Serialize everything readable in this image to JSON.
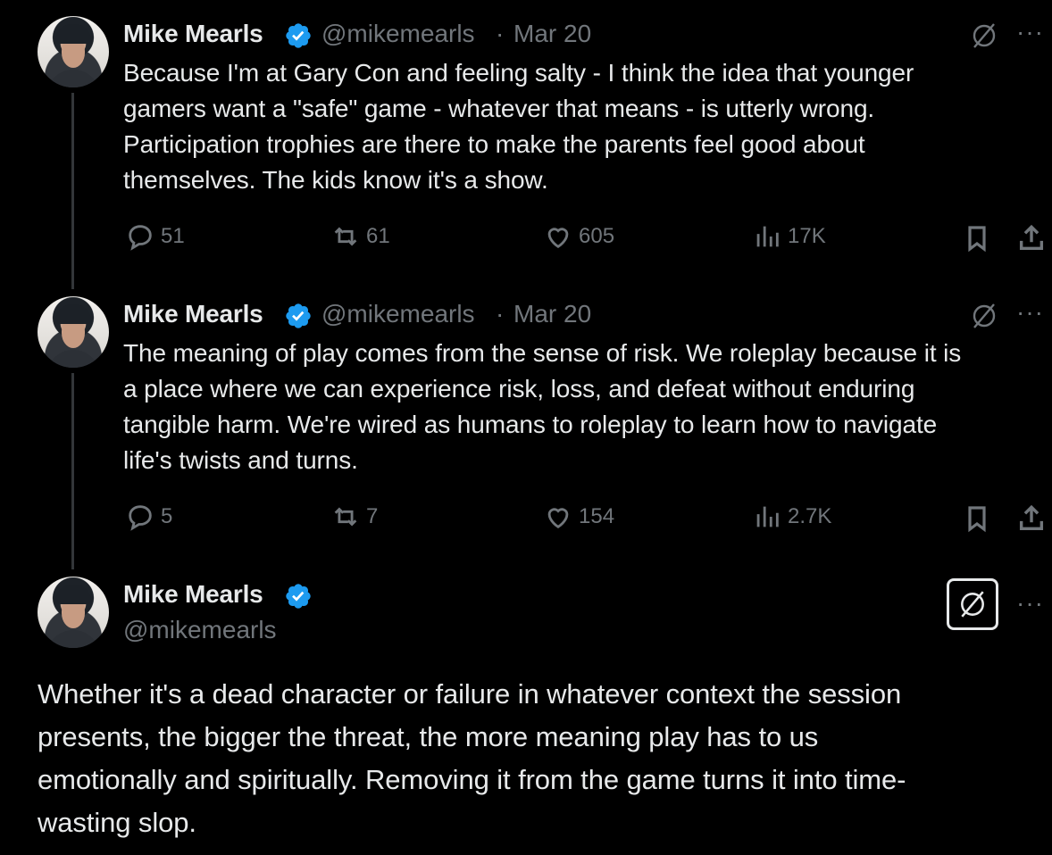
{
  "tweets": [
    {
      "name": "Mike Mearls",
      "handle": "@mikemearls",
      "date": "Mar 20",
      "text": "Because I'm at Gary Con and feeling salty - I think the idea that younger\ngamers want a \"safe\" game - whatever that means - is utterly wrong.\nParticipation trophies are there to make the parents feel good about\nthemselves. The kids know it's a show.",
      "replies": "51",
      "reposts": "61",
      "likes": "605",
      "views": "17K"
    },
    {
      "name": "Mike Mearls",
      "handle": "@mikemearls",
      "date": "Mar 20",
      "text": "The meaning of play comes from the sense of risk. We roleplay because it is\na place where we can experience risk, loss, and defeat without enduring\ntangible harm. We're wired as humans to roleplay to learn how to navigate\nlife's twists and turns.",
      "replies": "5",
      "reposts": "7",
      "likes": "154",
      "views": "2.7K"
    },
    {
      "name": "Mike Mearls",
      "handle": "@mikemearls",
      "text": "Whether it's a dead character or failure in whatever context the session\npresents, the bigger the threat, the more meaning play has to us\nemotionally and spiritually. Removing it from the game turns it into time-\nwasting slop."
    }
  ],
  "separator": "·",
  "more_glyph": "···",
  "colors": {
    "text": "#e7e9ea",
    "muted": "#71767b",
    "verified": "#1d9bf0",
    "background": "#000000"
  },
  "icons": [
    "reply-icon",
    "repost-icon",
    "like-icon",
    "views-icon",
    "bookmark-icon",
    "share-icon",
    "grok-icon",
    "more-icon",
    "verified-badge-icon"
  ]
}
